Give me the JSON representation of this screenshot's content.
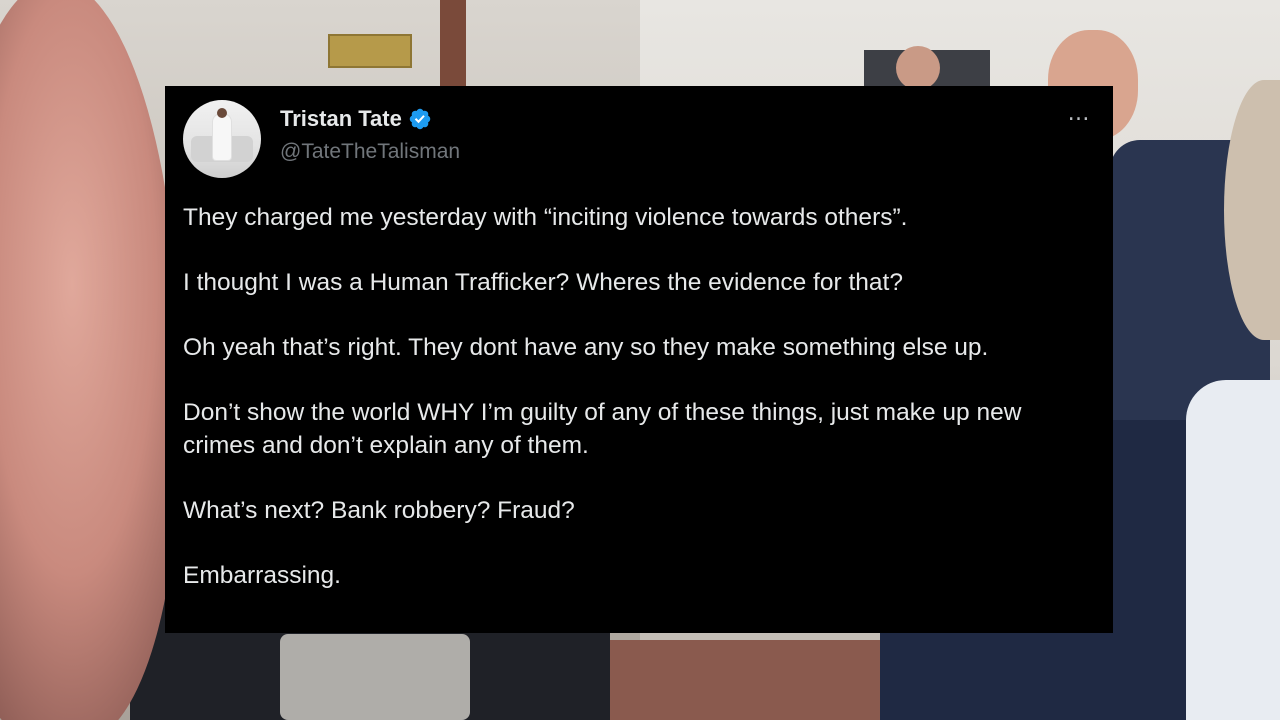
{
  "tweet": {
    "display_name": "Tristan Tate",
    "handle": "@TateTheTalisman",
    "verified": true,
    "more_icon": "…",
    "paragraphs": [
      "They charged me yesterday with “inciting violence towards others”.",
      "I thought I was a Human Trafficker? Wheres the evidence for that?",
      "Oh yeah that’s right. They dont have any so they make something else up.",
      "Don’t show the world WHY I’m guilty of any of these things, just make up new crimes and don’t explain any of them.",
      "What’s next? Bank robbery? Fraud?",
      "Embarrassing."
    ]
  },
  "colors": {
    "card_background": "#000000",
    "text_primary": "#e7e9ea",
    "text_secondary": "#71767b",
    "verified_badge": "#1d9bf0"
  },
  "icons": {
    "verified": "verified-badge-icon",
    "more": "more-options-icon"
  }
}
